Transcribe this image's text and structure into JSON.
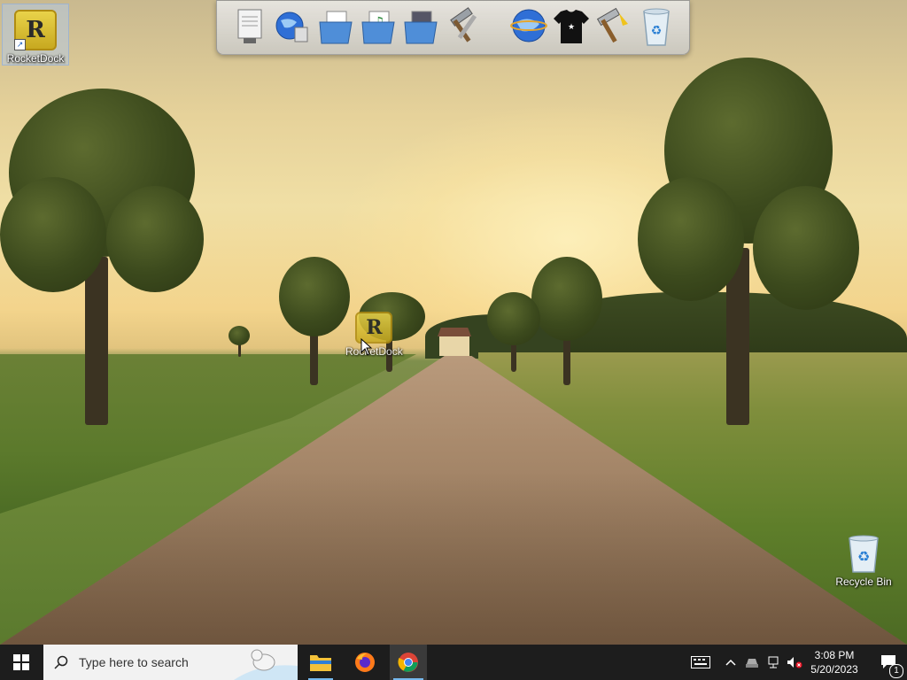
{
  "desktop": {
    "icons": [
      {
        "label": "RocketDock"
      },
      {
        "label": "RocketDock"
      },
      {
        "label": "Recycle Bin"
      }
    ],
    "rocketdock_glyph": "R"
  },
  "dock": {
    "items": [
      {
        "icon": "document-viewer-icon"
      },
      {
        "icon": "network-globe-icon"
      },
      {
        "icon": "documents-folder-icon"
      },
      {
        "icon": "music-folder-icon"
      },
      {
        "icon": "pictures-folder-icon"
      },
      {
        "icon": "tools-hammer-icon"
      },
      {
        "icon": "internet-globe-icon"
      },
      {
        "icon": "tshirt-icon"
      },
      {
        "icon": "settings-hammer-icon"
      },
      {
        "icon": "recycle-bin-icon"
      }
    ]
  },
  "taskbar": {
    "search_placeholder": "Type here to search",
    "pinned": [
      "file-explorer-icon",
      "firefox-icon",
      "chrome-icon"
    ],
    "active_app": "chrome-icon",
    "clock_time": "3:08 PM",
    "clock_date": "5/20/2023",
    "notification_count": "1"
  },
  "colors": {
    "taskbar_bg": "#1d1d1d",
    "accent": "#76b9ed"
  }
}
